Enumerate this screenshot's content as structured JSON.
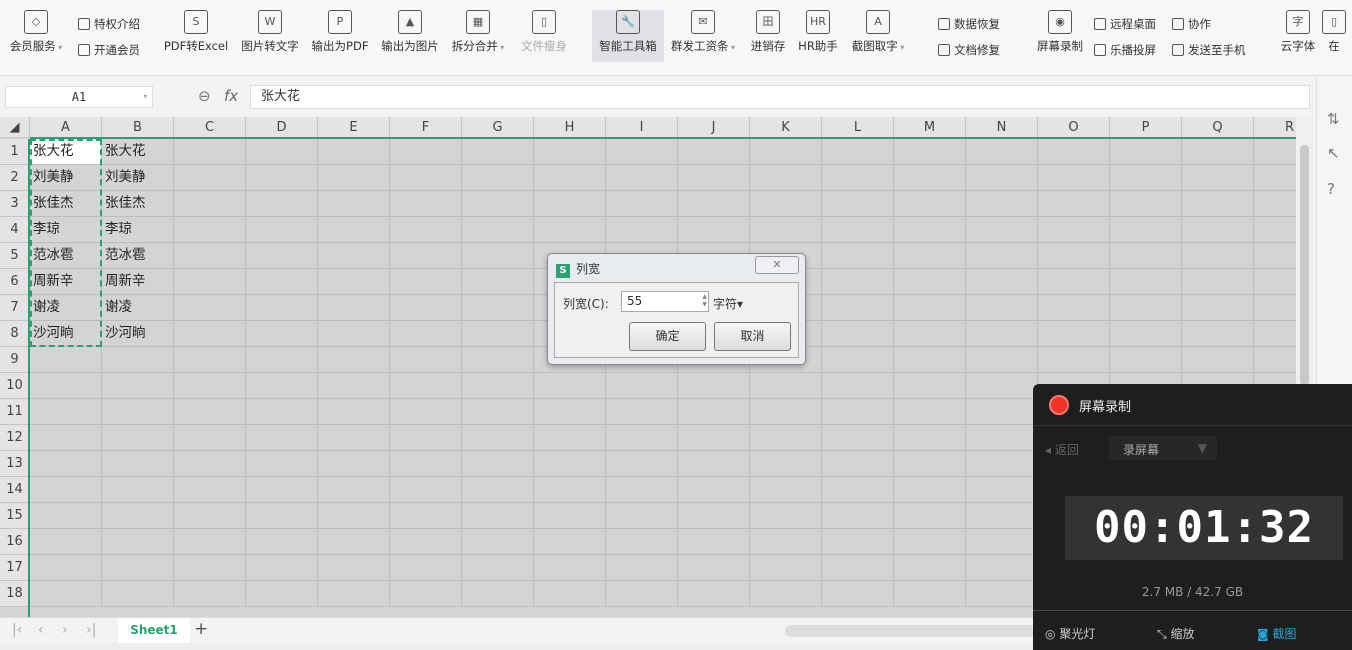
{
  "ribbon": {
    "big": [
      {
        "label": "会员服务",
        "icon": "diamond-icon",
        "dd": true
      },
      {
        "label": "PDF转Excel",
        "icon": "pdf-to-excel-icon"
      },
      {
        "label": "图片转文字",
        "icon": "image-to-text-icon"
      },
      {
        "label": "输出为PDF",
        "icon": "export-pdf-icon"
      },
      {
        "label": "输出为图片",
        "icon": "export-image-icon"
      },
      {
        "label": "拆分合并",
        "icon": "split-merge-icon",
        "dd": true
      },
      {
        "label": "文件瘦身",
        "icon": "file-slim-icon"
      },
      {
        "label": "智能工具箱",
        "icon": "toolbox-icon"
      },
      {
        "label": "群发工资条",
        "icon": "payroll-icon",
        "dd": true
      },
      {
        "label": "进销存",
        "icon": "inventory-icon"
      },
      {
        "label": "HR助手",
        "icon": "hr-icon"
      },
      {
        "label": "截图取字",
        "icon": "screenshot-ocr-icon",
        "dd": true
      },
      {
        "label": "屏幕录制",
        "icon": "screen-record-icon"
      },
      {
        "label": "云字体",
        "icon": "cloud-font-icon"
      },
      {
        "label": "在",
        "icon": "online-icon"
      }
    ],
    "small": [
      "特权介绍",
      "开通会员",
      "数据恢复",
      "文档修复",
      "远程桌面",
      "协作",
      "乐播投屏",
      "发送至手机"
    ]
  },
  "formula": {
    "cell": "A1",
    "fx": "fx",
    "value": "张大花"
  },
  "columns": [
    "A",
    "B",
    "C",
    "D",
    "E",
    "F",
    "G",
    "H",
    "I",
    "J",
    "K",
    "L",
    "M",
    "N",
    "O",
    "P",
    "Q",
    "R"
  ],
  "rows": [
    "1",
    "2",
    "3",
    "4",
    "5",
    "6",
    "7",
    "8",
    "9",
    "10",
    "11",
    "12",
    "13",
    "14",
    "15",
    "16",
    "17",
    "18"
  ],
  "cells": {
    "A": [
      "张大花",
      "刘美静",
      "张佳杰",
      "李琼",
      "范冰雹",
      "周新辛",
      "谢凌",
      "沙河晌"
    ],
    "B": [
      "张大花",
      "刘美静",
      "张佳杰",
      "李琼",
      "范冰雹",
      "周新辛",
      "谢凌",
      "沙河晌"
    ]
  },
  "tabs": {
    "sheet": "Sheet1",
    "add": "+"
  },
  "dialog": {
    "title": "列宽",
    "logo": "S",
    "label": "列宽(C):",
    "value": "55",
    "unit": "字符",
    "ok": "确定",
    "cancel": "取消"
  },
  "recorder": {
    "title": "屏幕录制",
    "back": "返回",
    "mode": "录屏幕",
    "time": "00:01:32",
    "size": "2.7 MB / 42.7 GB",
    "spotlight": "聚光灯",
    "zoom": "缩放",
    "screenshot": "截图"
  }
}
